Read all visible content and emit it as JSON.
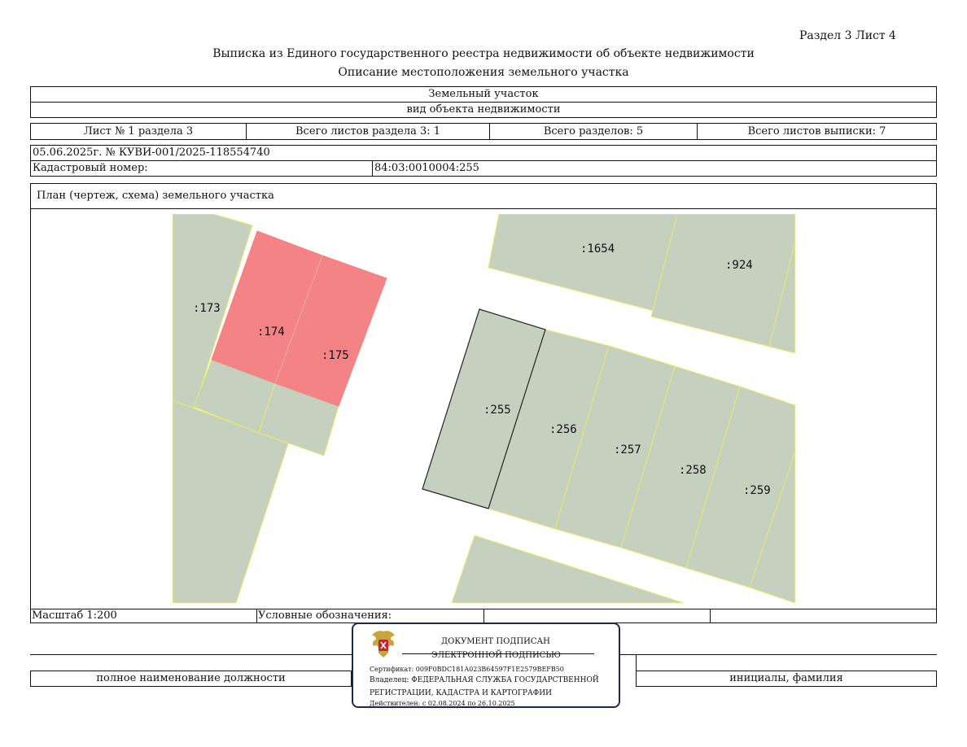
{
  "header": {
    "section_sheet": "Раздел 3   Лист 4",
    "title": "Выписка из Единого государственного реестра недвижимости об объекте недвижимости",
    "subtitle": "Описание местоположения земельного участка"
  },
  "object": {
    "type_value": "Земельный участок",
    "type_caption": "вид объекта недвижимости"
  },
  "sheet_info": {
    "sheet_no": "Лист № 1 раздела 3",
    "total_sheets_section": "Всего листов раздела 3: 1",
    "total_sections": "Всего разделов: 5",
    "total_sheets_extract": "Всего листов выписки: 7"
  },
  "doc_ref": "05.06.2025г. № КУВИ-001/2025-118554740",
  "cadastral": {
    "label": "Кадастровый номер:",
    "value": "84:03:0010004:255"
  },
  "plan_title": "План (чертеж, схема) земельного участка",
  "plan_labels": {
    "p173": ":173",
    "p174": ":174",
    "p175": ":175",
    "p1654": ":1654",
    "p924": ":924",
    "p255": ":255",
    "p256": ":256",
    "p257": ":257",
    "p258": ":258",
    "p259": ":259"
  },
  "colors": {
    "parcel": "#c5d0bf",
    "highlight": "#f38385",
    "boundary": "#e6ec6a",
    "stamp_border": "#1c2a4a"
  },
  "scale": "Масштаб 1:200",
  "legend_label": "Условные обозначения:",
  "signature": {
    "position_caption": "полное наименование должности",
    "name_caption": "инициалы, фамилия"
  },
  "stamp": {
    "emblem_icon": "coat-of-arms-icon",
    "line1": "ДОКУМЕНТ ПОДПИСАН",
    "line2": "ЭЛЕКТРОННОЙ ПОДПИСЬЮ",
    "certificate": "Сертификат: 009F0BDC181A023B64597F1E2579BEFB50",
    "owner": "Владелец: ФЕДЕРАЛЬНАЯ СЛУЖБА ГОСУДАРСТВЕННОЙ",
    "owner2": "РЕГИСТРАЦИИ, КАДАСТРА И КАРТОГРАФИИ",
    "validity": "Действителен: с 02.08.2024 по 26.10.2025"
  }
}
